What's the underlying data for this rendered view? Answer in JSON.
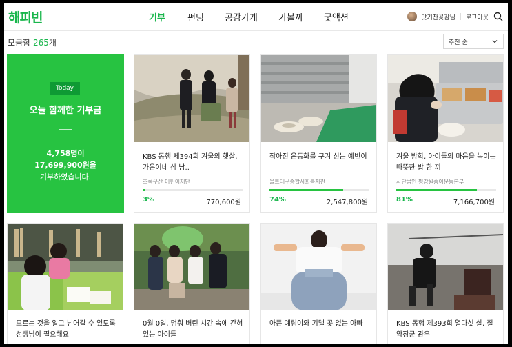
{
  "header": {
    "logo": "해피빈",
    "nav": [
      "기부",
      "펀딩",
      "공감가게",
      "가볼까",
      "굿액션"
    ],
    "active_nav": "기부",
    "user_name": "맛기찬곶감님",
    "logout": "로그아웃",
    "search_icon": "search-icon"
  },
  "listing": {
    "count_prefix": "모금함 ",
    "count_num": "265",
    "count_suffix": "개",
    "sort_value": "추천 순"
  },
  "today": {
    "badge": "Today",
    "title": "오늘 함께한 기부금",
    "line1": "4,758명이",
    "line2": "17,699,900원을",
    "line3": "기부하였습니다."
  },
  "colors": {
    "brand": "#19b64c",
    "today_bg": "#27c341"
  },
  "cards": [
    {
      "title": "KBS 동행 제394회 겨울의 햇살, 가은이네 삼 남..",
      "org": "초록우산 어린이재단",
      "percent": "3%",
      "progress": 0.03,
      "amount": "770,600원"
    },
    {
      "title": "작아진 운동화를 구겨 신는 예빈이",
      "org": "울트대구종합사회복지관",
      "percent": "74%",
      "progress": 0.74,
      "amount": "2,547,800원"
    },
    {
      "title": "겨울 방학, 아이들의 마음을 녹이는 따뜻한 밥 한 끼",
      "org": "사단법인 펑강원승이운동본부",
      "percent": "81%",
      "progress": 0.81,
      "amount": "7,166,700원"
    },
    {
      "title": "모르는 것을 알고 넘어갈 수 있도록 선생님이 필요해요"
    },
    {
      "title": "0월 0일, 멈춰 버린 시간 속에 갇혀 있는 아이들"
    },
    {
      "title": "아픈 예림이와 기댈 곳 없는 아빠"
    },
    {
      "title": "KBS 동행 제393회 열다섯 살, 절약장군 관우"
    }
  ]
}
